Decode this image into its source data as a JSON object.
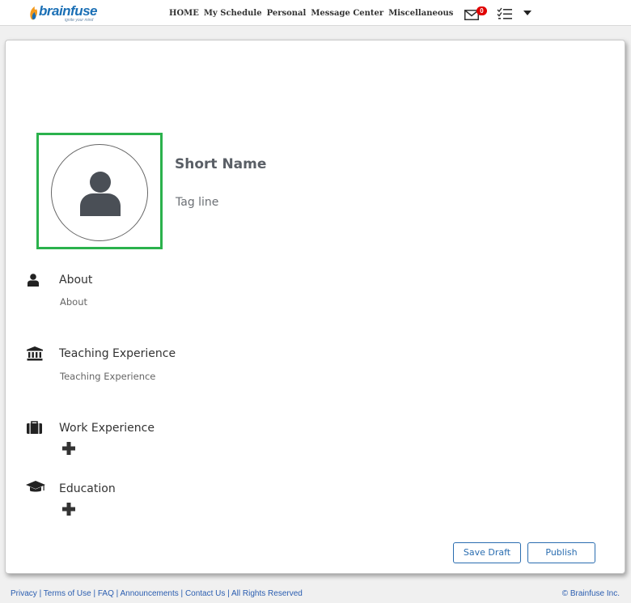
{
  "header": {
    "logo_text": "brainfuse",
    "logo_tagline": "ignite your mind",
    "nav": [
      "HOME",
      "My Schedule",
      "Personal",
      "Message Center",
      "Miscellaneous"
    ],
    "mail_badge": "0"
  },
  "profile": {
    "short_name": "Short Name",
    "tag_line": "Tag line"
  },
  "sections": {
    "about": {
      "title": "About",
      "subtitle": "About",
      "icon": "user-icon"
    },
    "teaching": {
      "title": "Teaching Experience",
      "subtitle": "Teaching Experience",
      "icon": "institution-icon"
    },
    "work": {
      "title": "Work Experience",
      "icon": "briefcase-icon"
    },
    "education": {
      "title": "Education",
      "icon": "graduation-cap-icon"
    }
  },
  "actions": {
    "save_draft": "Save Draft",
    "publish": "Publish"
  },
  "footer": {
    "links": [
      "Privacy",
      "Terms of Use",
      "FAQ",
      "Announcements",
      "Contact Us",
      "All Rights Reserved"
    ],
    "copyright": "© Brainfuse Inc."
  },
  "colors": {
    "accent": "#2a6db0",
    "photo_border": "#2bb24c",
    "badge": "#e00000"
  }
}
